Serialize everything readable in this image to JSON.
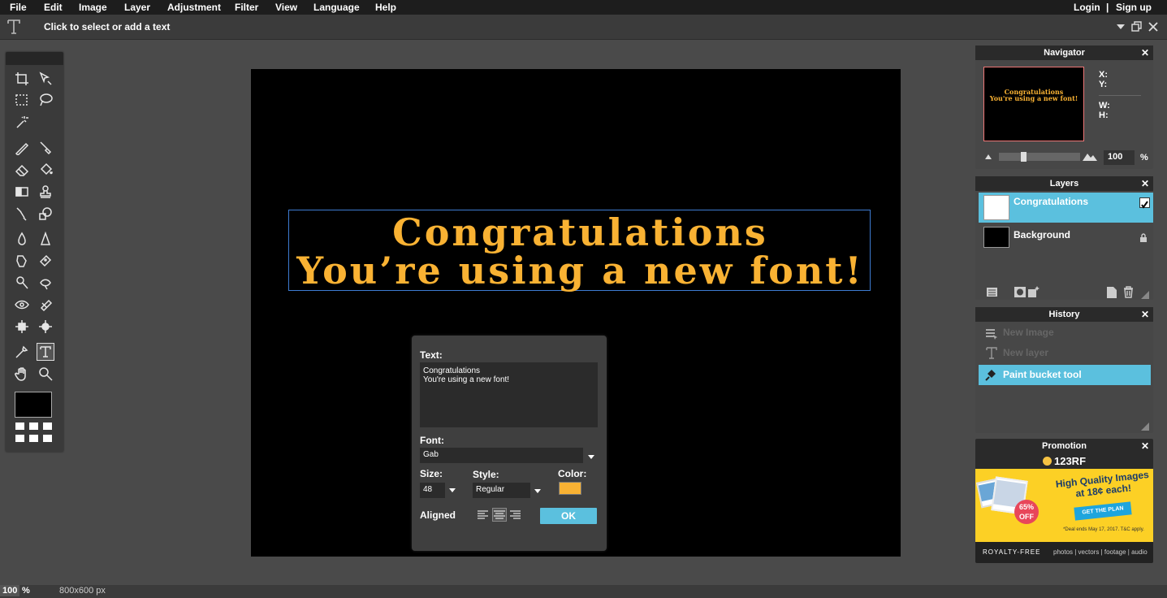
{
  "menubar": {
    "items": [
      "File",
      "Edit",
      "Image",
      "Layer",
      "Adjustment",
      "Filter",
      "View",
      "Language",
      "Help"
    ],
    "login": "Login",
    "separator": "|",
    "signup": "Sign up"
  },
  "optionsbar": {
    "hint": "Click to select or add a text"
  },
  "canvas_text": {
    "line1": "Congratulations",
    "line2": "You’re using a new font!"
  },
  "text_dialog": {
    "text_label": "Text:",
    "text_value": "Congratulations\nYou're using a new font!",
    "font_label": "Font:",
    "font_value": "Gab",
    "size_label": "Size:",
    "size_value": "48",
    "style_label": "Style:",
    "style_value": "Regular",
    "color_label": "Color:",
    "color_value": "#f9b233",
    "aligned_label": "Aligned",
    "ok_label": "OK"
  },
  "navigator": {
    "title": "Navigator",
    "x_label": "X:",
    "y_label": "Y:",
    "w_label": "W:",
    "h_label": "H:",
    "zoom_value": "100",
    "zoom_unit": "%",
    "thumb_line1": "Congratulations",
    "thumb_line2": "You're using a new font!"
  },
  "layers": {
    "title": "Layers",
    "items": [
      {
        "name": "Congratulations",
        "selected": true
      },
      {
        "name": "Background",
        "selected": false
      }
    ]
  },
  "history": {
    "title": "History",
    "items": [
      {
        "label": "New Image"
      },
      {
        "label": "New layer"
      },
      {
        "label": "Paint bucket tool"
      }
    ]
  },
  "promotion": {
    "title": "Promotion",
    "brand": "123RF",
    "headline": "High Quality Images at 18¢ each!",
    "cta": "GET THE PLAN",
    "discount": "65% OFF",
    "fineprint": "*Deal ends May 17, 2017. T&C apply.",
    "footer_left": "ROYALTY-FREE",
    "footer_right": "photos | vectors | footage | audio"
  },
  "statusbar": {
    "zoom": "100",
    "zoom_unit": "%",
    "size": "800x600 px"
  },
  "colors": {
    "accent": "#5bc0de",
    "text_color": "#f9b233",
    "selection": "#3d7bd1"
  }
}
